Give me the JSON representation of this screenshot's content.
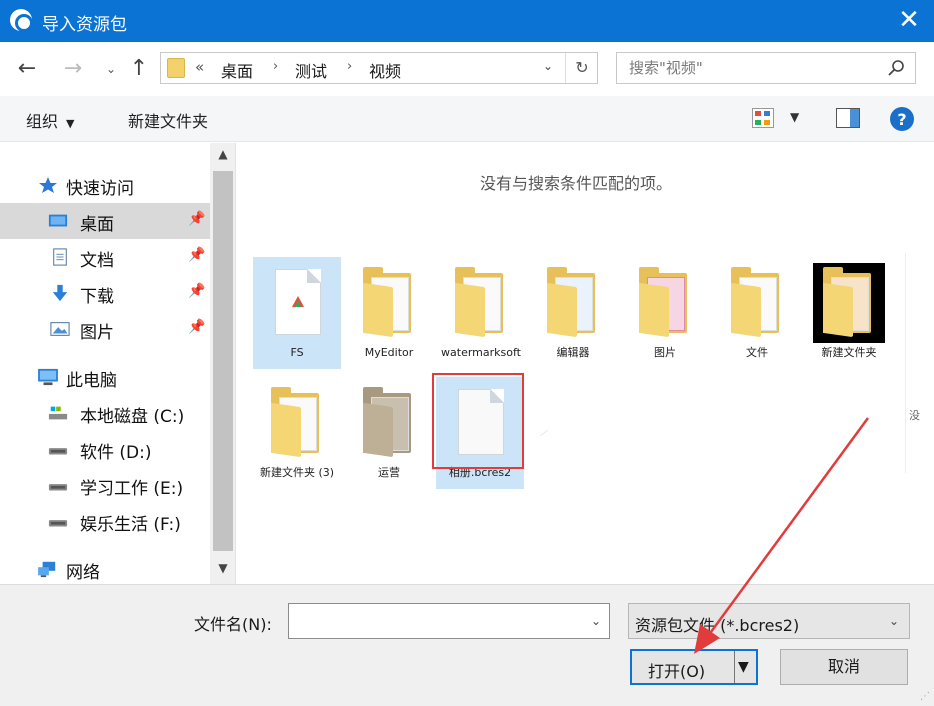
{
  "window": {
    "title": "导入资源包"
  },
  "nav": {
    "breadcrumbs": [
      "桌面",
      "测试",
      "视频"
    ],
    "search_placeholder": "搜索\"视频\""
  },
  "toolbar": {
    "organize": "组织",
    "new_folder": "新建文件夹"
  },
  "sidebar": {
    "quick_access": "快速访问",
    "quick_items": [
      "桌面",
      "文档",
      "下载",
      "图片"
    ],
    "this_pc": "此电脑",
    "drives": [
      "本地磁盘 (C:)",
      "软件 (D:)",
      "学习工作 (E:)",
      "娱乐生活 (F:)"
    ],
    "network": "网络"
  },
  "content": {
    "empty_message": "没有与搜索条件匹配的项。",
    "edge_text": "没",
    "items": [
      {
        "name": "FS",
        "kind": "folder-doc"
      },
      {
        "name": "MyEditor",
        "kind": "folder"
      },
      {
        "name": "watermarksoft",
        "kind": "folder"
      },
      {
        "name": "编辑器",
        "kind": "folder"
      },
      {
        "name": "图片",
        "kind": "folder"
      },
      {
        "name": "文件",
        "kind": "folder"
      },
      {
        "name": "新建文件夹",
        "kind": "folder-dark"
      },
      {
        "name": "新建文件夹 (3)",
        "kind": "folder"
      },
      {
        "name": "运营",
        "kind": "folder"
      },
      {
        "name": "相册.bcres2",
        "kind": "file"
      }
    ]
  },
  "bottom": {
    "filename_label": "文件名(N):",
    "filename_value": "",
    "filetype": "资源包文件 (*.bcres2)",
    "open_label": "打开(O)",
    "cancel_label": "取消"
  },
  "colors": {
    "accent": "#0a73d4",
    "highlight": "#cce4f7",
    "annotation": "#e23b3b"
  }
}
